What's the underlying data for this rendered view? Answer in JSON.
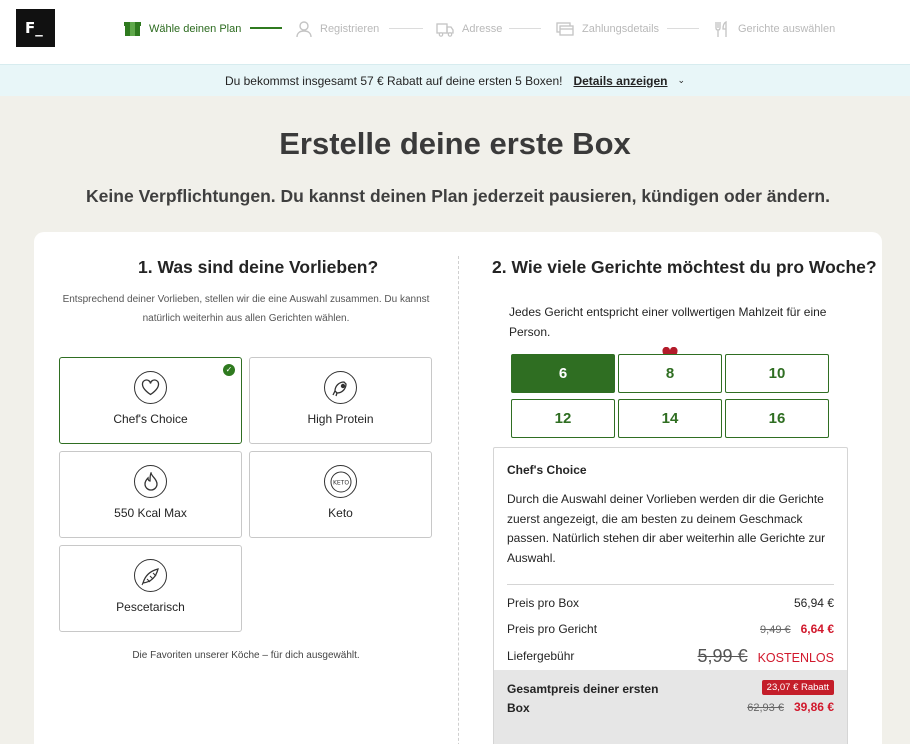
{
  "logo": "F_",
  "steps": [
    {
      "label": "Wähle deinen Plan",
      "active": true
    },
    {
      "label": "Registrieren",
      "active": false
    },
    {
      "label": "Adresse",
      "active": false
    },
    {
      "label": "Zahlungsdetails",
      "active": false
    },
    {
      "label": "Gerichte auswählen",
      "active": false
    }
  ],
  "promo": {
    "message": "Du bekommst insgesamt 57 € Rabatt auf deine ersten 5 Boxen!",
    "details": "Details anzeigen"
  },
  "title": "Erstelle deine erste Box",
  "subtitle": "Keine Verpflichtungen. Du kannst deinen Plan jederzeit pausieren, kündigen oder ändern.",
  "preferences": {
    "heading": "1. Was sind deine Vorlieben?",
    "description": "Entsprechend deiner Vorlieben, stellen wir die eine Auswahl zusammen. Du kannst natürlich weiterhin aus allen Gerichten wählen.",
    "options": [
      {
        "label": "Chef's Choice",
        "icon": "heart-icon",
        "selected": true
      },
      {
        "label": "High Protein",
        "icon": "protein-icon",
        "selected": false
      },
      {
        "label": "550 Kcal Max",
        "icon": "flame-icon",
        "selected": false
      },
      {
        "label": "Keto",
        "icon": "keto-icon",
        "selected": false
      },
      {
        "label": "Pescetarisch",
        "icon": "fish-icon",
        "selected": false
      }
    ],
    "footer": "Die Favoriten unserer Köche – für dich ausgewählt."
  },
  "meals": {
    "heading": "2. Wie viele Gerichte möchtest du pro Woche?",
    "info": "Jedes Gericht entspricht einer vollwertigen Mahlzeit für eine Person.",
    "counts": [
      "6",
      "8",
      "10",
      "12",
      "14",
      "16"
    ],
    "selected": "6",
    "favorite": "8"
  },
  "summary": {
    "title": "Chef's Choice",
    "description": "Durch die Auswahl deiner Vorlieben werden dir die Gerichte zuerst angezeigt, die am besten zu deinem Geschmack passen. Natürlich stehen dir aber weiterhin alle Gerichte zur Auswahl.",
    "price_box_label": "Preis pro Box",
    "price_box": "56,94 €",
    "price_meal_label": "Preis pro Gericht",
    "price_meal_old": "9,49 €",
    "price_meal_new": "6,64 €",
    "shipping_label": "Liefergebühr",
    "shipping_old": "5,99 €",
    "shipping_new": "KOSTENLOS",
    "total_label": "Gesamtpreis deiner ersten Box",
    "discount_badge": "23,07 € Rabatt",
    "total_old": "62,93 €",
    "total_new": "39,86 €"
  },
  "colors": {
    "primary_green": "#2f6e22",
    "promo_bg": "#e8f6f8",
    "sale_red": "#d1182c"
  }
}
